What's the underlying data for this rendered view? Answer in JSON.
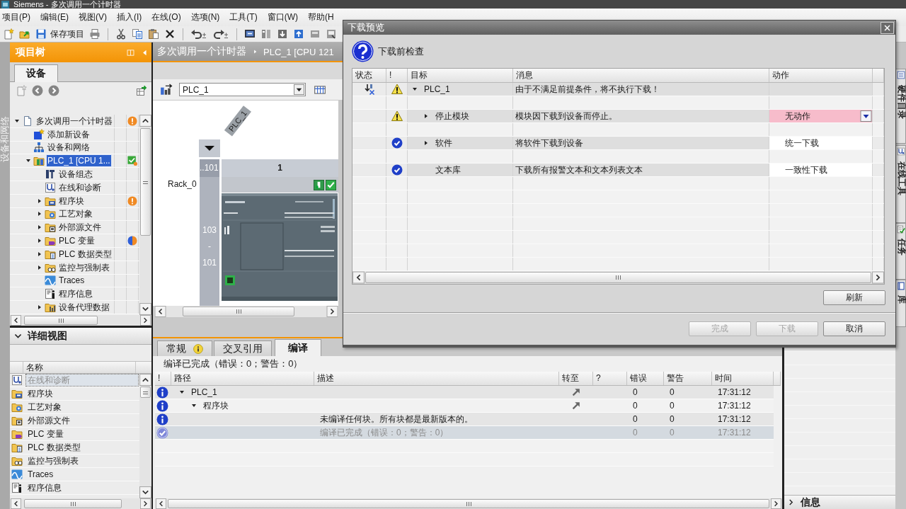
{
  "window": {
    "title": "Siemens - 多次调用一个计时器"
  },
  "menu": [
    {
      "label": "项目(P)"
    },
    {
      "label": "编辑(E)"
    },
    {
      "label": "视图(V)"
    },
    {
      "label": "插入(I)"
    },
    {
      "label": "在线(O)"
    },
    {
      "label": "选项(N)"
    },
    {
      "label": "工具(T)"
    },
    {
      "label": "窗口(W)"
    },
    {
      "label": "帮助(H"
    }
  ],
  "toolbar": {
    "save_label": "保存项目"
  },
  "left_strip": {
    "label": "设备和网络"
  },
  "project_tree": {
    "title": "项目树",
    "tabs": [
      {
        "label": "设备",
        "selected": true
      }
    ],
    "items": [
      {
        "label": "多次调用一个计时器",
        "kind": "project",
        "expanded": true,
        "selected": false,
        "badge": {
          "kind": "warning"
        },
        "children": [
          {
            "label": "添加新设备",
            "kind": "add",
            "selected": false
          },
          {
            "label": "设备和网络",
            "kind": "network",
            "selected": false
          },
          {
            "label": "PLC_1 [CPU 1...",
            "kind": "plc",
            "expanded": true,
            "selected": true,
            "badge": {
              "kind": "ok-warning"
            },
            "children": [
              {
                "label": "设备组态",
                "kind": "config",
                "selected": false
              },
              {
                "label": "在线和诊断",
                "kind": "diagnostics",
                "selected": false
              },
              {
                "label": "程序块",
                "kind": "blocks",
                "expanded": false,
                "selected": false,
                "badge": {
                  "kind": "warning"
                }
              },
              {
                "label": "工艺对象",
                "kind": "technology",
                "expanded": false,
                "selected": false
              },
              {
                "label": "外部源文件",
                "kind": "sources",
                "expanded": false,
                "selected": false
              },
              {
                "label": "PLC 变量",
                "kind": "tags",
                "expanded": false,
                "selected": false,
                "badge": {
                  "kind": "mixed"
                }
              },
              {
                "label": "PLC 数据类型",
                "kind": "types",
                "expanded": false,
                "selected": false
              },
              {
                "label": "监控与强制表",
                "kind": "watch",
                "expanded": false,
                "selected": false
              },
              {
                "label": "Traces",
                "kind": "traces",
                "selected": false
              },
              {
                "label": "程序信息",
                "kind": "info",
                "selected": false
              },
              {
                "label": "设备代理数据",
                "kind": "proxy",
                "expanded": false,
                "selected": false
              }
            ]
          }
        ]
      }
    ]
  },
  "details_view": {
    "title": "详细视图",
    "column": "名称",
    "items": [
      {
        "label": "在线和诊断",
        "kind": "diagnostics",
        "selected": true
      },
      {
        "label": "程序块",
        "kind": "blocks",
        "selected": false
      },
      {
        "label": "工艺对象",
        "kind": "technology",
        "selected": false
      },
      {
        "label": "外部源文件",
        "kind": "sources",
        "selected": false
      },
      {
        "label": "PLC 变量",
        "kind": "tags",
        "selected": false
      },
      {
        "label": "PLC 数据类型",
        "kind": "types",
        "selected": false
      },
      {
        "label": "监控与强制表",
        "kind": "watch",
        "selected": false
      },
      {
        "label": "Traces",
        "kind": "traces",
        "selected": false
      },
      {
        "label": "程序信息",
        "kind": "info",
        "selected": false
      }
    ]
  },
  "editor": {
    "breadcrumb": [
      {
        "label": "多次调用一个计时器"
      },
      {
        "label": "PLC_1 [CPU 121"
      }
    ],
    "device_select": {
      "value": "PLC_1"
    },
    "device_tag": "PLC_1",
    "rack_label": "Rack_0",
    "slot_headers": [
      "..101",
      "1"
    ],
    "slot_numbers": [
      "103",
      "-",
      "101"
    ]
  },
  "inspector": {
    "tabs": [
      {
        "label": "常规",
        "selected": false,
        "info": true
      },
      {
        "label": "交叉引用",
        "selected": false,
        "info": false
      },
      {
        "label": "编译",
        "selected": true,
        "info": false
      }
    ],
    "summary": "编译已完成（错误：0；警告：0）",
    "columns": [
      "!",
      "路径",
      "描述",
      "转至",
      "?",
      "错误",
      "警告",
      "时间"
    ],
    "rows": [
      {
        "kind": "info",
        "path": "PLC_1",
        "expanded": true,
        "goto": true,
        "errors": "0",
        "warnings": "0",
        "time": "17:31:12",
        "selected": false,
        "children": [
          {
            "kind": "info",
            "path": "程序块",
            "expanded": true,
            "goto": true,
            "errors": "0",
            "warnings": "0",
            "time": "17:31:12",
            "selected": false,
            "children": [
              {
                "kind": "info",
                "description": "未编译任何块。所有块都是最新版本的。",
                "goto": false,
                "errors": "0",
                "warnings": "0",
                "time": "17:31:12",
                "selected": false
              }
            ]
          }
        ]
      },
      {
        "kind": "done",
        "description": "编译已完成（错误：0；警告：0）",
        "goto": false,
        "errors": "0",
        "warnings": "0",
        "time": "17:31:12",
        "selected": true
      }
    ]
  },
  "task_panel": {
    "info_label": "信息"
  },
  "right_tabs": [
    {
      "label": "硬件目录",
      "selected": false
    },
    {
      "label": "在线工具",
      "selected": false
    },
    {
      "label": "任务",
      "selected": false
    },
    {
      "label": "库",
      "selected": false
    }
  ],
  "dialog": {
    "title": "下载预览",
    "heading": "下载前检查",
    "columns": [
      "状态",
      "!",
      "目标",
      "消息",
      "动作"
    ],
    "rows": [
      {
        "kind": "warning",
        "status": {
          "kind": "download-blocked"
        },
        "target": "PLC_1",
        "expanded": true,
        "message": "由于不满足前提条件，将不执行下载！",
        "children": [
          {
            "kind": "warning",
            "target": "停止模块",
            "expanded": false,
            "message": "模块因下载到设备而停止。",
            "action": {
              "value": "无动作",
              "error": true,
              "dropdown": true
            }
          },
          {
            "kind": "ok",
            "target": "软件",
            "expanded": false,
            "message": "将软件下载到设备",
            "action": {
              "value": "统一下载",
              "error": false,
              "dropdown": false
            }
          },
          {
            "kind": "ok",
            "target": "文本库",
            "message": "下载所有报警文本和文本列表文本",
            "action": {
              "value": "一致性下载",
              "error": false,
              "dropdown": false
            }
          }
        ]
      }
    ],
    "refresh_button": "刷新",
    "buttons": [
      {
        "label": "完成",
        "disabled": true
      },
      {
        "label": "下载",
        "disabled": true
      },
      {
        "label": "取消",
        "disabled": false
      }
    ]
  }
}
